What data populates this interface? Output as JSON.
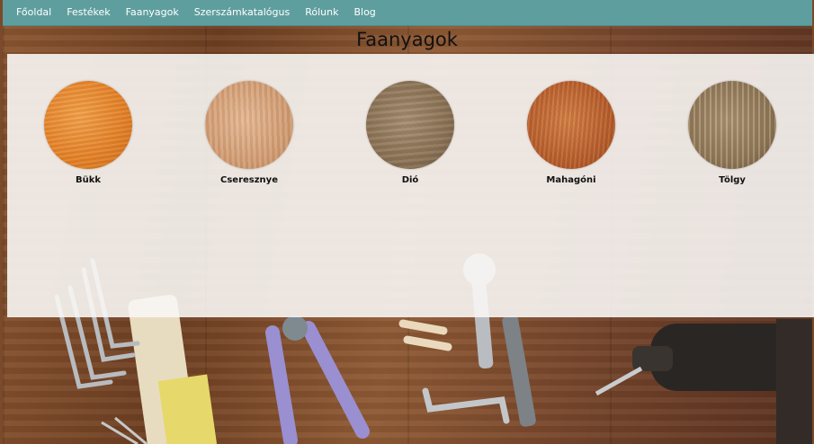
{
  "nav": {
    "items": [
      {
        "label": "Főoldal"
      },
      {
        "label": "Festékek"
      },
      {
        "label": "Faanyagok"
      },
      {
        "label": "Szerszámkatalógus"
      },
      {
        "label": "Rólunk"
      },
      {
        "label": "Blog"
      }
    ]
  },
  "page": {
    "title": "Faanyagok"
  },
  "woods": [
    {
      "label": "Bükk",
      "icon": "beech-wood-texture"
    },
    {
      "label": "Cseresznye",
      "icon": "cherry-wood-texture"
    },
    {
      "label": "Dió",
      "icon": "walnut-wood-texture"
    },
    {
      "label": "Mahagóni",
      "icon": "mahogany-wood-texture"
    },
    {
      "label": "Tölgy",
      "icon": "oak-wood-texture"
    }
  ],
  "colors": {
    "nav_background": "#5f9e9e",
    "panel_background": "#f8f6f4"
  }
}
